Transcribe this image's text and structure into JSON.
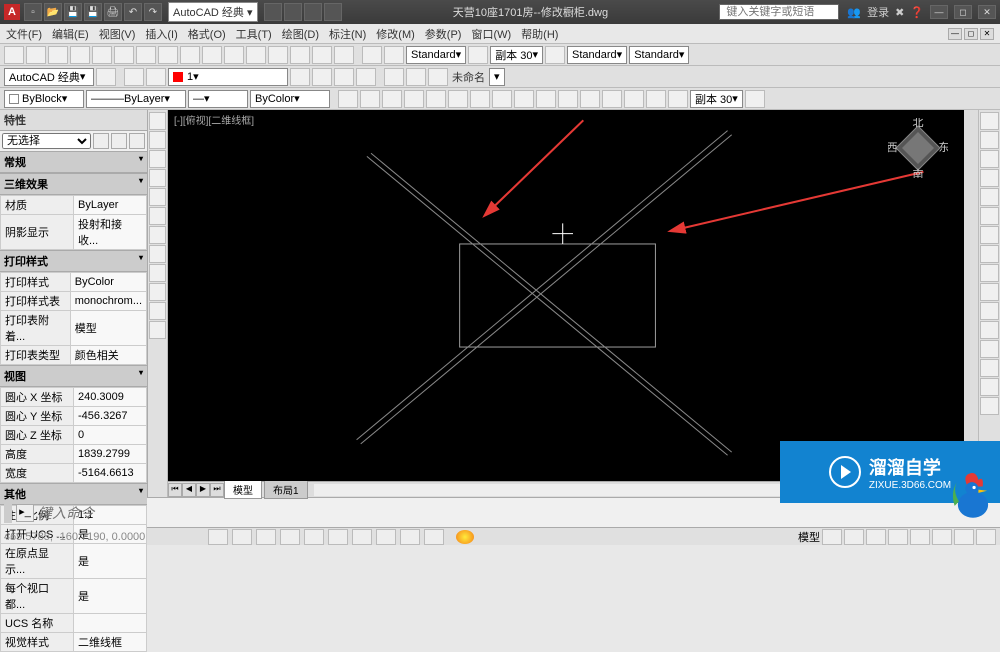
{
  "titlebar": {
    "logo": "A",
    "workspace": "AutoCAD 经典",
    "title": "天营10座1701房--修改橱柜.dwg",
    "search_placeholder": "键入关键字或短语",
    "login": "登录"
  },
  "menus": [
    "文件(F)",
    "编辑(E)",
    "视图(V)",
    "插入(I)",
    "格式(O)",
    "工具(T)",
    "绘图(D)",
    "标注(N)",
    "修改(M)",
    "参数(P)",
    "窗口(W)",
    "帮助(H)"
  ],
  "toolbar2": {
    "workspace": "AutoCAD 经典",
    "layer": "1",
    "dimstyle1": "Standard",
    "dimstyle2": "副本 30",
    "dimstyle3": "Standard",
    "dimstyle4": "Standard"
  },
  "toolbar3": {
    "color": "ByBlock",
    "layer": "ByLayer",
    "ltype": "—",
    "lweight": "ByColor",
    "group": "未命名"
  },
  "toolbar4": {
    "dim": "副本 30"
  },
  "props": {
    "title": "特性",
    "selection": "无选择",
    "sections": {
      "general": "常规",
      "effect3d": "三维效果",
      "printstyle": "打印样式",
      "view": "视图",
      "other": "其他"
    },
    "effect3d": [
      {
        "k": "材质",
        "v": "ByLayer"
      },
      {
        "k": "阴影显示",
        "v": "投射和接收..."
      }
    ],
    "printstyle": [
      {
        "k": "打印样式",
        "v": "ByColor"
      },
      {
        "k": "打印样式表",
        "v": "monochrom..."
      },
      {
        "k": "打印表附着...",
        "v": "模型"
      },
      {
        "k": "打印表类型",
        "v": "颜色相关"
      }
    ],
    "view": [
      {
        "k": "圆心 X 坐标",
        "v": "240.3009"
      },
      {
        "k": "圆心 Y 坐标",
        "v": "-456.3267"
      },
      {
        "k": "圆心 Z 坐标",
        "v": "0"
      },
      {
        "k": "高度",
        "v": "1839.2799"
      },
      {
        "k": "宽度",
        "v": "-5164.6613"
      }
    ],
    "other": [
      {
        "k": "注释比例",
        "v": "1:1"
      },
      {
        "k": "打开 UCS ...",
        "v": "是"
      },
      {
        "k": "在原点显示...",
        "v": "是"
      },
      {
        "k": "每个视口都...",
        "v": "是"
      },
      {
        "k": "UCS 名称",
        "v": ""
      },
      {
        "k": "视觉样式",
        "v": "二维线框"
      }
    ]
  },
  "viewport": {
    "label": "[-][俯视][二维线框]",
    "compass": {
      "n": "北",
      "s": "南",
      "e": "东",
      "w": "西"
    }
  },
  "tabs": {
    "model": "模型",
    "layout1": "布局1"
  },
  "cmd": {
    "placeholder": "键入命令"
  },
  "status": {
    "coords": "469.5785,    -160.7190, 0.0000",
    "model": "模型"
  },
  "watermark": {
    "brand": "溜溜自学",
    "url": "ZIXUE.3D66.COM"
  }
}
